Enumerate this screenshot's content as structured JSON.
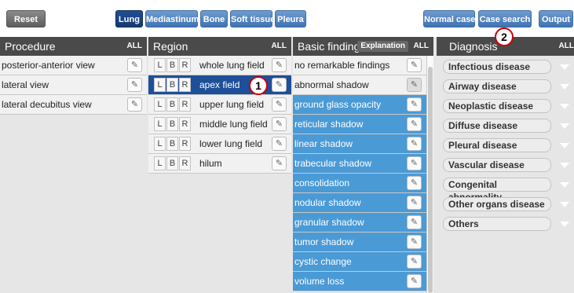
{
  "toolbar": {
    "reset": "Reset",
    "tabs": [
      "Lung",
      "Mediastinum",
      "Bone",
      "Soft tissue",
      "Pleura"
    ],
    "normal_case": "Normal case",
    "case_search": "Case search",
    "output": "Output"
  },
  "procedure": {
    "title": "Procedure",
    "all": "ALL",
    "items": [
      "posterior-anterior view",
      "lateral view",
      "lateral decubitus view"
    ]
  },
  "region": {
    "title": "Region",
    "all": "ALL",
    "lbr": [
      "L",
      "B",
      "R"
    ],
    "items": [
      "whole lung field",
      "apex field",
      "upper lung field",
      "middle lung field",
      "lower lung field",
      "hilum"
    ],
    "selected": "apex field"
  },
  "findings": {
    "title": "Basic findings",
    "explanation": "Explanation",
    "all": "ALL",
    "items": [
      "no remarkable findings",
      "abnormal shadow",
      "ground glass opacity",
      "reticular shadow",
      "linear shadow",
      "trabecular shadow",
      "consolidation",
      "nodular shadow",
      "granular shadow",
      "tumor shadow",
      "cystic change",
      "volume loss"
    ]
  },
  "diagnosis": {
    "title": "Diagnosis",
    "all": "ALL",
    "items": [
      "Infectious disease",
      "Airway disease",
      "Neoplastic disease",
      "Diffuse disease",
      "Pleural disease",
      "Vascular disease",
      "Congenital abnormality",
      "Other organs disease",
      "Others"
    ]
  },
  "markers": [
    "1",
    "2"
  ],
  "icons": {
    "edit": "edit-note-icon",
    "dropdown": "triangle-down-icon"
  },
  "colors": {
    "selected": "#1e4f98",
    "finding_blue": "#4a9ad6",
    "header": "#4a4a4a",
    "button": "#3f73b2"
  }
}
